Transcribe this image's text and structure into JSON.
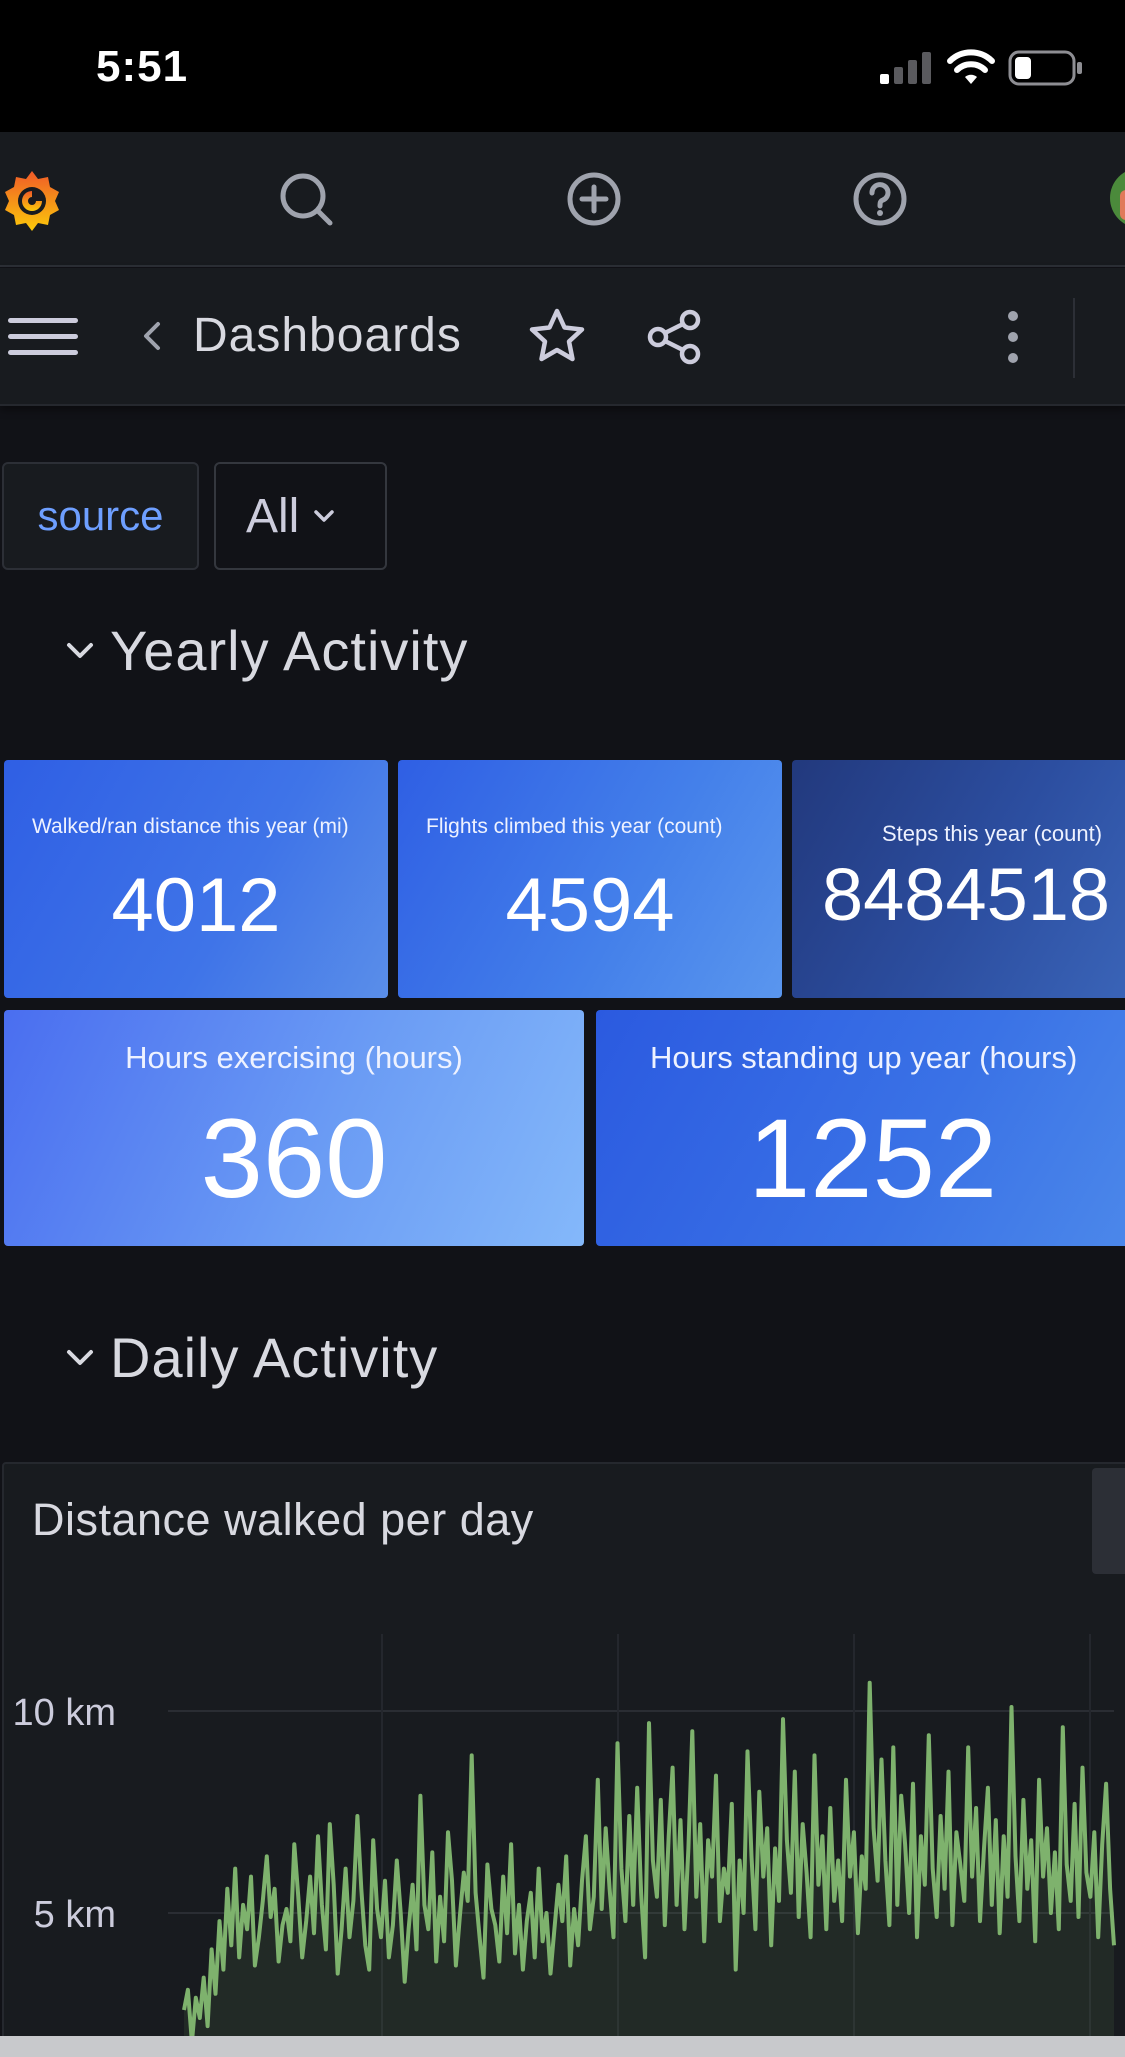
{
  "status_bar": {
    "time": "5:51"
  },
  "top_bar": {
    "icons": [
      "grafana-logo-icon",
      "search-icon",
      "plus-circle-icon",
      "help-icon",
      "avatar"
    ]
  },
  "nav_bar": {
    "title": "Dashboards",
    "icons": [
      "menu-icon",
      "chevron-left-icon",
      "star-icon",
      "share-icon",
      "kebab-icon"
    ]
  },
  "variables": {
    "label": "source",
    "value": "All"
  },
  "rows": [
    {
      "title": "Yearly Activity"
    },
    {
      "title": "Daily Activity"
    }
  ],
  "stats": [
    {
      "label": "Walked/ran distance this year (mi)",
      "value": "4012"
    },
    {
      "label": "Flights climbed this year (count)",
      "value": "4594"
    },
    {
      "label": "Steps this year (count)",
      "value": "8484518"
    },
    {
      "label": "Hours exercising (hours)",
      "value": "360"
    },
    {
      "label": "Hours standing up year (hours)",
      "value": "1252"
    }
  ],
  "colors": {
    "background": "#111217",
    "panel": "#181b1f",
    "accent_blue": "#6e9fff",
    "series_green": "#7eb26d"
  },
  "chart_data": {
    "type": "line",
    "title": "Distance walked per day",
    "xlabel": "",
    "ylabel": "",
    "y_ticks": [
      "10 km",
      "5 km"
    ],
    "ylim": [
      0,
      11.5
    ],
    "series": [
      {
        "values": [
          2.6,
          3.1,
          1.8,
          2.9,
          2.4,
          3.4,
          2.2,
          4.1,
          3.0,
          4.8,
          3.6,
          5.6,
          4.2,
          6.1,
          3.9,
          5.2,
          4.6,
          5.9,
          3.7,
          4.4,
          5.3,
          6.4,
          4.9,
          5.6,
          3.8,
          4.7,
          5.1,
          4.3,
          6.7,
          5.4,
          3.9,
          4.8,
          5.9,
          4.5,
          6.9,
          5.2,
          4.1,
          7.2,
          5.7,
          3.5,
          4.6,
          6.1,
          4.4,
          5.3,
          7.4,
          5.6,
          4.2,
          3.6,
          6.8,
          5.1,
          4.4,
          5.8,
          3.9,
          4.7,
          6.3,
          5.0,
          3.3,
          4.6,
          5.7,
          4.1,
          7.9,
          5.2,
          4.6,
          6.5,
          3.8,
          5.4,
          4.3,
          7.0,
          5.8,
          3.7,
          4.9,
          6.0,
          5.3,
          8.9,
          5.5,
          4.4,
          3.4,
          6.2,
          5.1,
          4.7,
          3.8,
          5.9,
          4.5,
          6.7,
          4.0,
          5.2,
          3.6,
          4.8,
          5.5,
          3.9,
          6.1,
          4.3,
          5.0,
          3.5,
          4.6,
          5.7,
          4.8,
          6.4,
          3.7,
          5.1,
          4.2,
          5.8,
          6.9,
          4.6,
          5.4,
          8.3,
          5.1,
          7.1,
          5.6,
          4.4,
          9.2,
          6.1,
          4.8,
          7.4,
          5.2,
          8.1,
          5.5,
          3.9,
          9.7,
          6.3,
          5.4,
          7.8,
          4.7,
          6.9,
          8.6,
          5.2,
          7.3,
          4.6,
          6.6,
          9.5,
          5.4,
          7.2,
          4.3,
          6.8,
          5.9,
          8.4,
          4.8,
          6.1,
          5.5,
          7.7,
          3.6,
          6.3,
          5.0,
          9.0,
          6.4,
          4.6,
          8.0,
          5.9,
          7.1,
          4.2,
          6.6,
          5.3,
          9.8,
          6.8,
          5.5,
          8.5,
          4.9,
          7.2,
          6.0,
          4.4,
          8.9,
          5.7,
          6.9,
          4.6,
          7.6,
          5.3,
          6.3,
          4.8,
          8.3,
          5.9,
          7.0,
          4.5,
          6.4,
          5.6,
          10.7,
          7.1,
          5.8,
          8.8,
          6.3,
          4.7,
          9.1,
          5.2,
          7.9,
          6.7,
          5.0,
          8.2,
          4.4,
          6.9,
          5.7,
          9.4,
          6.1,
          4.9,
          7.4,
          5.6,
          8.5,
          4.7,
          7.0,
          6.2,
          5.3,
          9.1,
          5.9,
          7.6,
          4.8,
          6.6,
          8.1,
          5.2,
          7.3,
          4.5,
          6.9,
          5.4,
          10.1,
          6.4,
          4.8,
          7.8,
          5.6,
          6.8,
          4.3,
          8.3,
          5.9,
          7.1,
          5.0,
          6.5,
          4.6,
          9.6,
          6.2,
          5.3,
          7.7,
          4.9,
          8.6,
          6.0,
          5.4,
          7.0,
          4.4,
          6.7,
          8.2,
          5.6,
          4.2
        ]
      }
    ]
  }
}
